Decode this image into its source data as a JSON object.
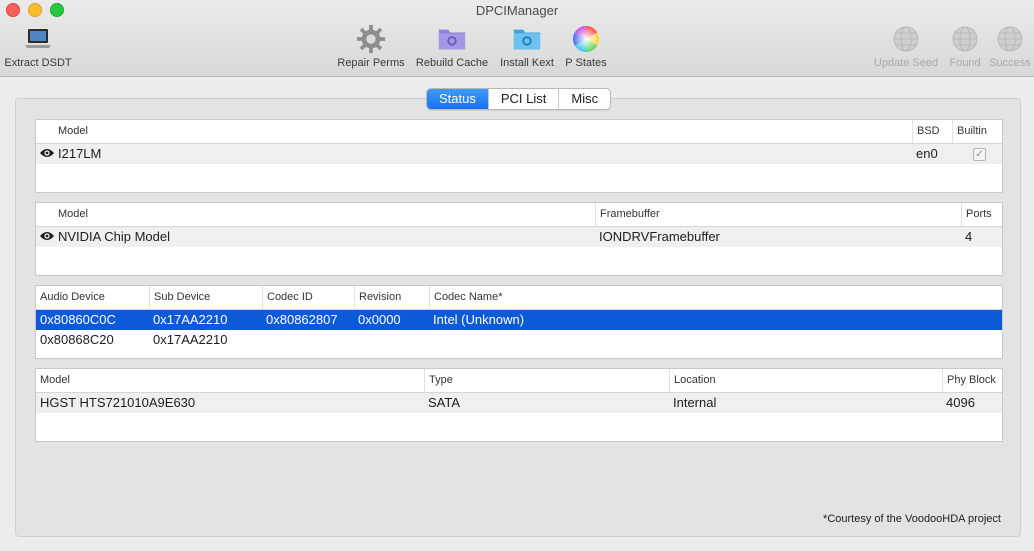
{
  "window": {
    "title": "DPCIManager"
  },
  "toolbar": {
    "extract_dsdt": "Extract DSDT",
    "repair_perms": "Repair Perms",
    "rebuild_cache": "Rebuild Cache",
    "install_kext": "Install Kext",
    "p_states": "P States",
    "update_seed": "Update Seed",
    "found": "Found",
    "success": "Success"
  },
  "tabs": [
    {
      "label": "Status",
      "active": true
    },
    {
      "label": "PCI List",
      "active": false
    },
    {
      "label": "Misc",
      "active": false
    }
  ],
  "network_table": {
    "headers": {
      "model": "Model",
      "bsd": "BSD",
      "builtin": "Builtin"
    },
    "rows": [
      {
        "model": "I217LM",
        "bsd": "en0",
        "builtin": true
      }
    ]
  },
  "graphics_table": {
    "headers": {
      "model": "Model",
      "framebuffer": "Framebuffer",
      "ports": "Ports"
    },
    "rows": [
      {
        "model": "NVIDIA Chip Model",
        "framebuffer": "IONDRVFramebuffer",
        "ports": "4"
      }
    ]
  },
  "audio_table": {
    "headers": {
      "audio_device": "Audio Device",
      "sub_device": "Sub Device",
      "codec_id": "Codec ID",
      "revision": "Revision",
      "codec_name": "Codec Name*"
    },
    "rows": [
      {
        "audio_device": "0x80860C0C",
        "sub_device": "0x17AA2210",
        "codec_id": "0x80862807",
        "revision": "0x0000",
        "codec_name": "Intel (Unknown)",
        "selected": true
      },
      {
        "audio_device": "0x80868C20",
        "sub_device": "0x17AA2210",
        "codec_id": "",
        "revision": "",
        "codec_name": "",
        "selected": false
      }
    ]
  },
  "disk_table": {
    "headers": {
      "model": "Model",
      "type": "Type",
      "location": "Location",
      "phy_block": "Phy Block"
    },
    "rows": [
      {
        "model": "HGST HTS721010A9E630",
        "type": "SATA",
        "location": "Internal",
        "phy_block": "4096"
      }
    ]
  },
  "credit": "*Courtesy of the VoodooHDA project",
  "colors": {
    "accent": "#1a70f0",
    "selection": "#0d5ad9"
  }
}
